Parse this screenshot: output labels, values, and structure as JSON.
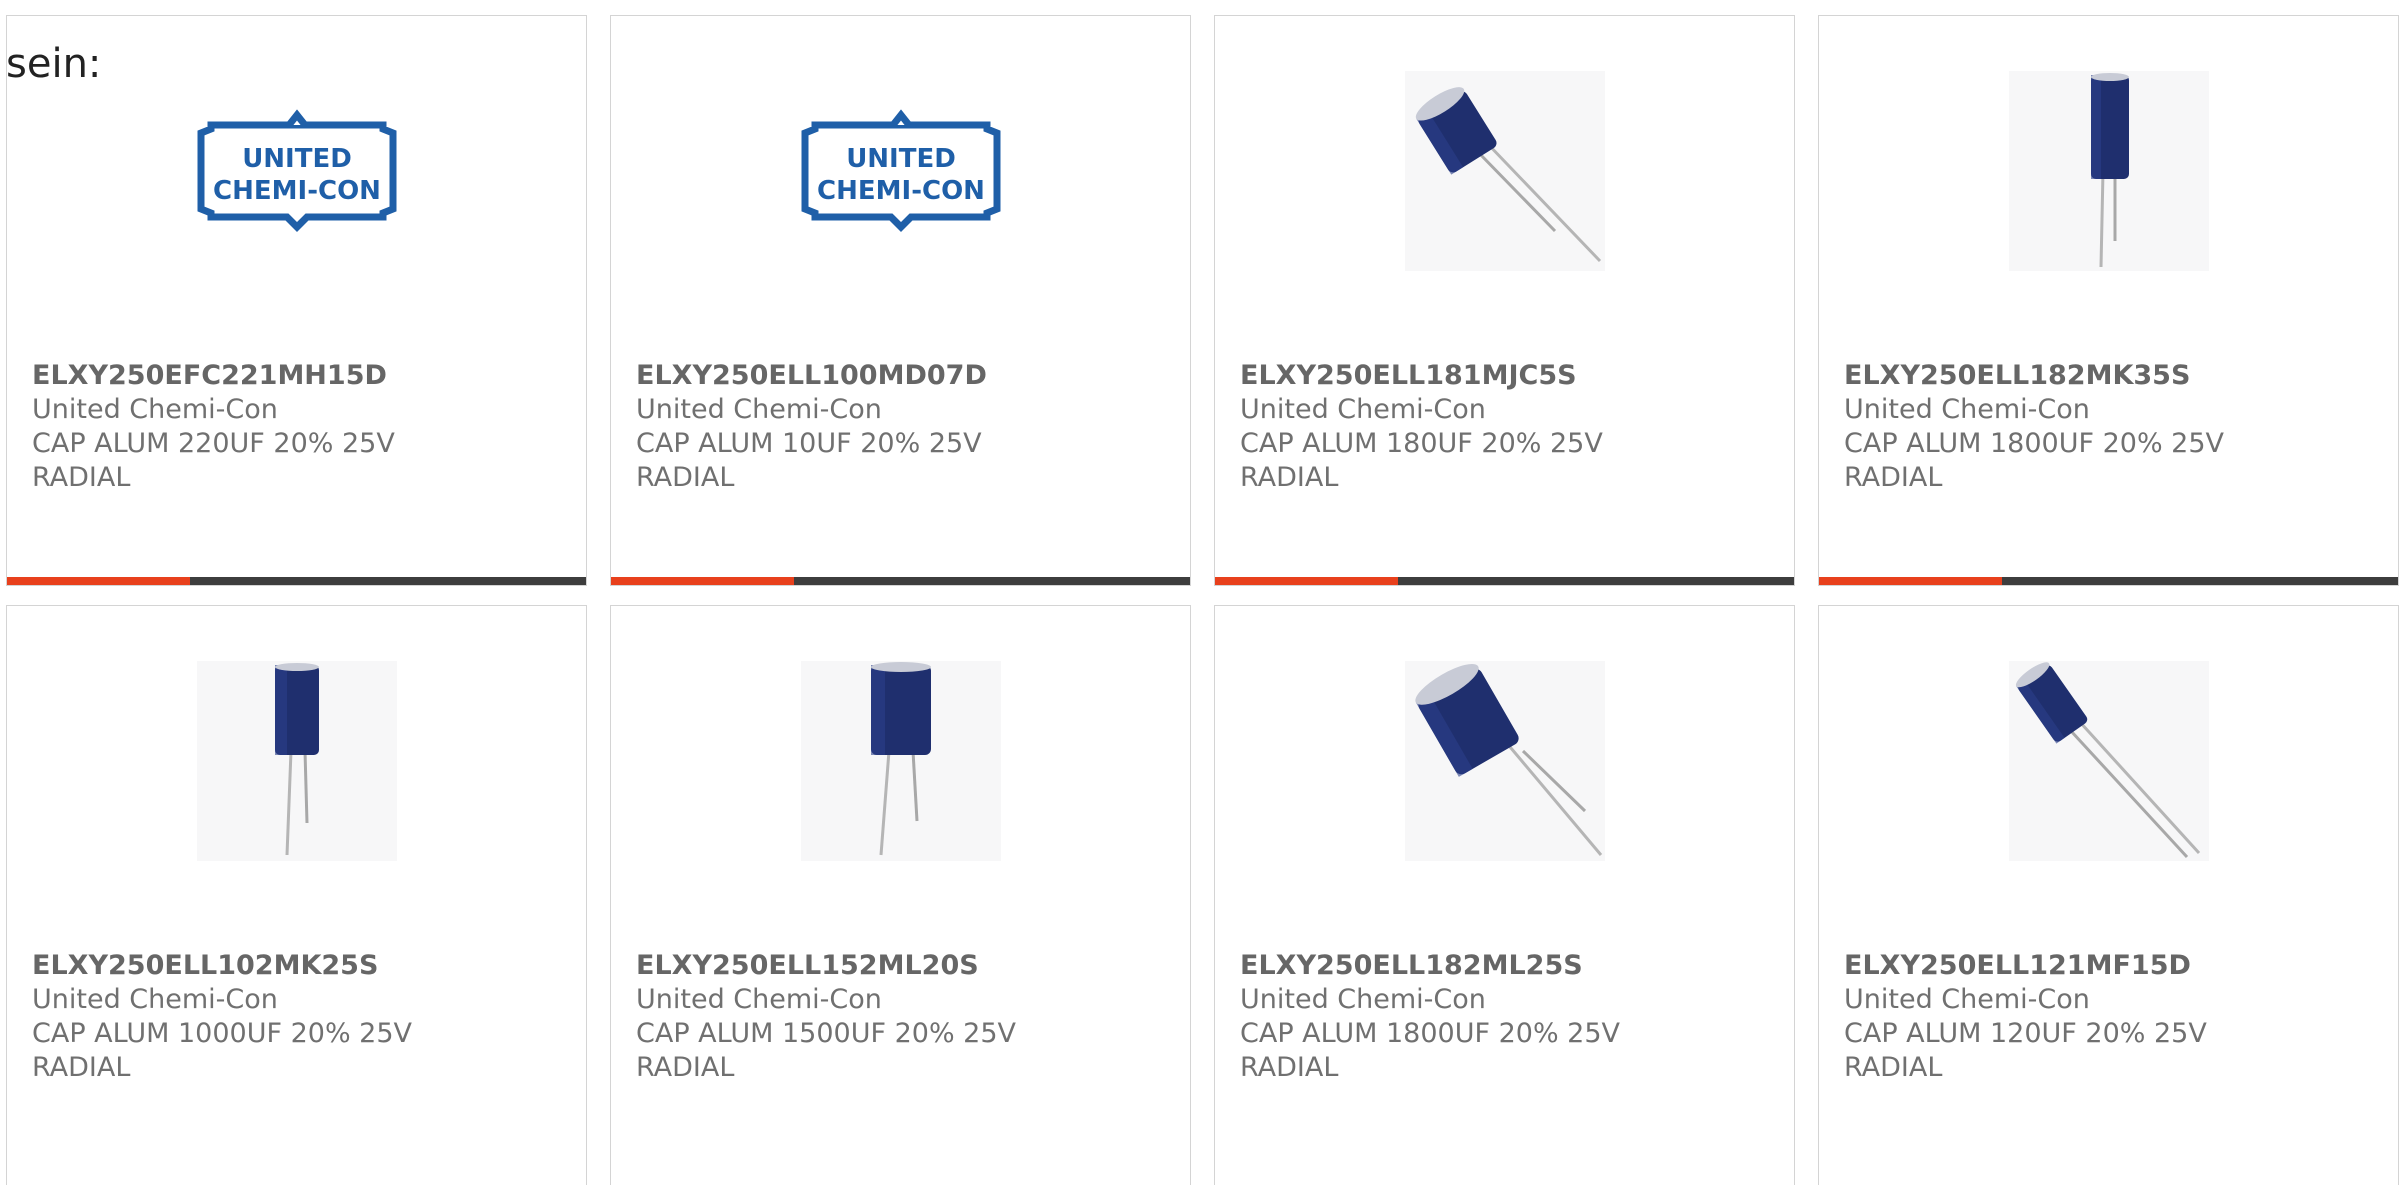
{
  "header": {
    "text": "sein:"
  },
  "colors": {
    "accent": "#e8401c",
    "bar": "#3d3d3d",
    "brand_blue": "#1f5fa8",
    "cap_blue": "#1f2f6e"
  },
  "products": [
    {
      "part": "ELXY250EFC221MH15D",
      "mfr": "United Chemi-Con",
      "desc1": "CAP ALUM 220UF 20% 25V",
      "desc2": "RADIAL",
      "image": "united-chemi-con-logo",
      "logo_line1": "UNITED",
      "logo_line2": "CHEMI-CON"
    },
    {
      "part": "ELXY250ELL100MD07D",
      "mfr": "United Chemi-Con",
      "desc1": "CAP ALUM 10UF 20% 25V",
      "desc2": "RADIAL",
      "image": "united-chemi-con-logo",
      "logo_line1": "UNITED",
      "logo_line2": "CHEMI-CON"
    },
    {
      "part": "ELXY250ELL181MJC5S",
      "mfr": "United Chemi-Con",
      "desc1": "CAP ALUM 180UF 20% 25V",
      "desc2": "RADIAL",
      "image": "capacitor-photo"
    },
    {
      "part": "ELXY250ELL182MK35S",
      "mfr": "United Chemi-Con",
      "desc1": "CAP ALUM 1800UF 20% 25V",
      "desc2": "RADIAL",
      "image": "capacitor-photo"
    },
    {
      "part": "ELXY250ELL102MK25S",
      "mfr": "United Chemi-Con",
      "desc1": "CAP ALUM 1000UF 20% 25V",
      "desc2": "RADIAL",
      "image": "capacitor-photo"
    },
    {
      "part": "ELXY250ELL152ML20S",
      "mfr": "United Chemi-Con",
      "desc1": "CAP ALUM 1500UF 20% 25V",
      "desc2": "RADIAL",
      "image": "capacitor-photo"
    },
    {
      "part": "ELXY250ELL182ML25S",
      "mfr": "United Chemi-Con",
      "desc1": "CAP ALUM 1800UF 20% 25V",
      "desc2": "RADIAL",
      "image": "capacitor-photo"
    },
    {
      "part": "ELXY250ELL121MF15D",
      "mfr": "United Chemi-Con",
      "desc1": "CAP ALUM 120UF 20% 25V",
      "desc2": "RADIAL",
      "image": "capacitor-photo"
    }
  ]
}
